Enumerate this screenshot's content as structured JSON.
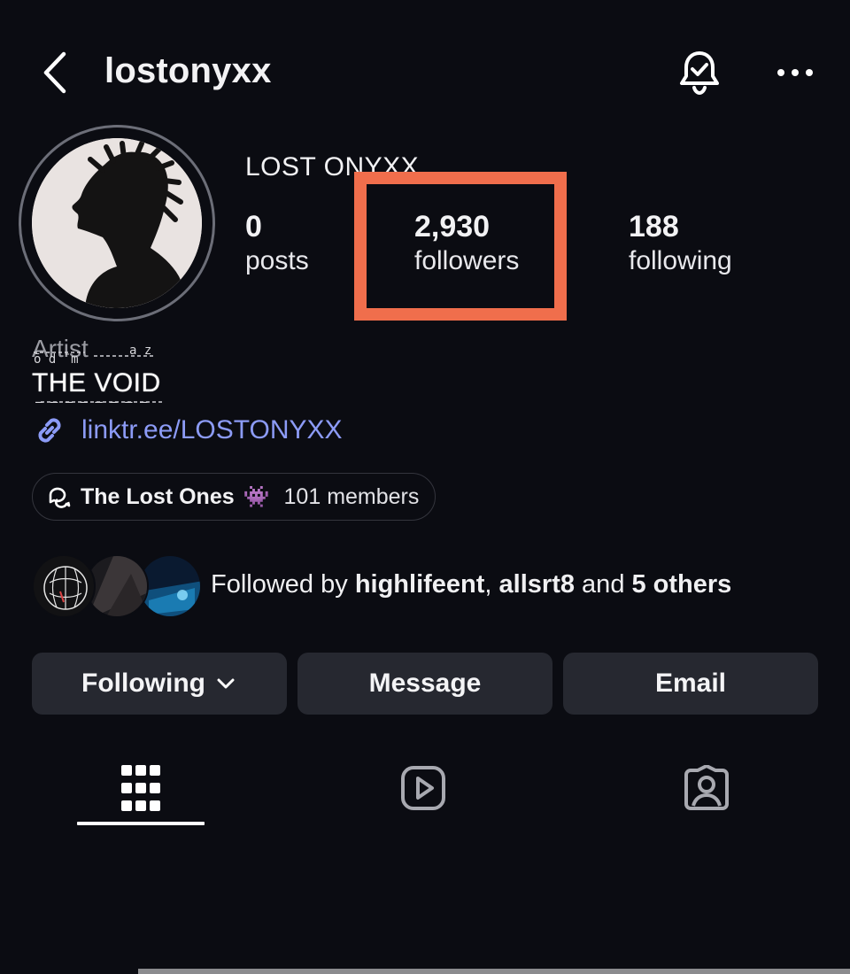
{
  "header": {
    "username": "lostonyxx",
    "icons": {
      "back": "chevron-left-icon",
      "notifications": "bell-check-icon",
      "more": "more-horizontal-icon"
    }
  },
  "profile": {
    "display_name": "LOST ONYXX",
    "stats": {
      "posts": {
        "value": "0",
        "label": "posts"
      },
      "followers": {
        "value": "2,930",
        "label": "followers"
      },
      "following": {
        "value": "188",
        "label": "following"
      }
    },
    "highlight_color": "#f06e4c"
  },
  "bio": {
    "category": "Artist",
    "line": "THE VOID",
    "link_text": "linktr.ee/LOSTONYXX",
    "link_color": "#8c9bf6"
  },
  "channel": {
    "name": "The Lost Ones",
    "emoji": "👾",
    "members": "101 members"
  },
  "followed_by": {
    "prefix": "Followed by ",
    "user1": "highlifeent",
    "separator": ", ",
    "user2": "allsrt8",
    "middle": " and ",
    "others": "5 others"
  },
  "actions": {
    "following_label": "Following",
    "message_label": "Message",
    "email_label": "Email"
  },
  "tabs": [
    "grid-icon",
    "reels-icon",
    "tagged-icon"
  ],
  "theme": {
    "background": "#0b0c12",
    "button_bg": "#262830"
  }
}
